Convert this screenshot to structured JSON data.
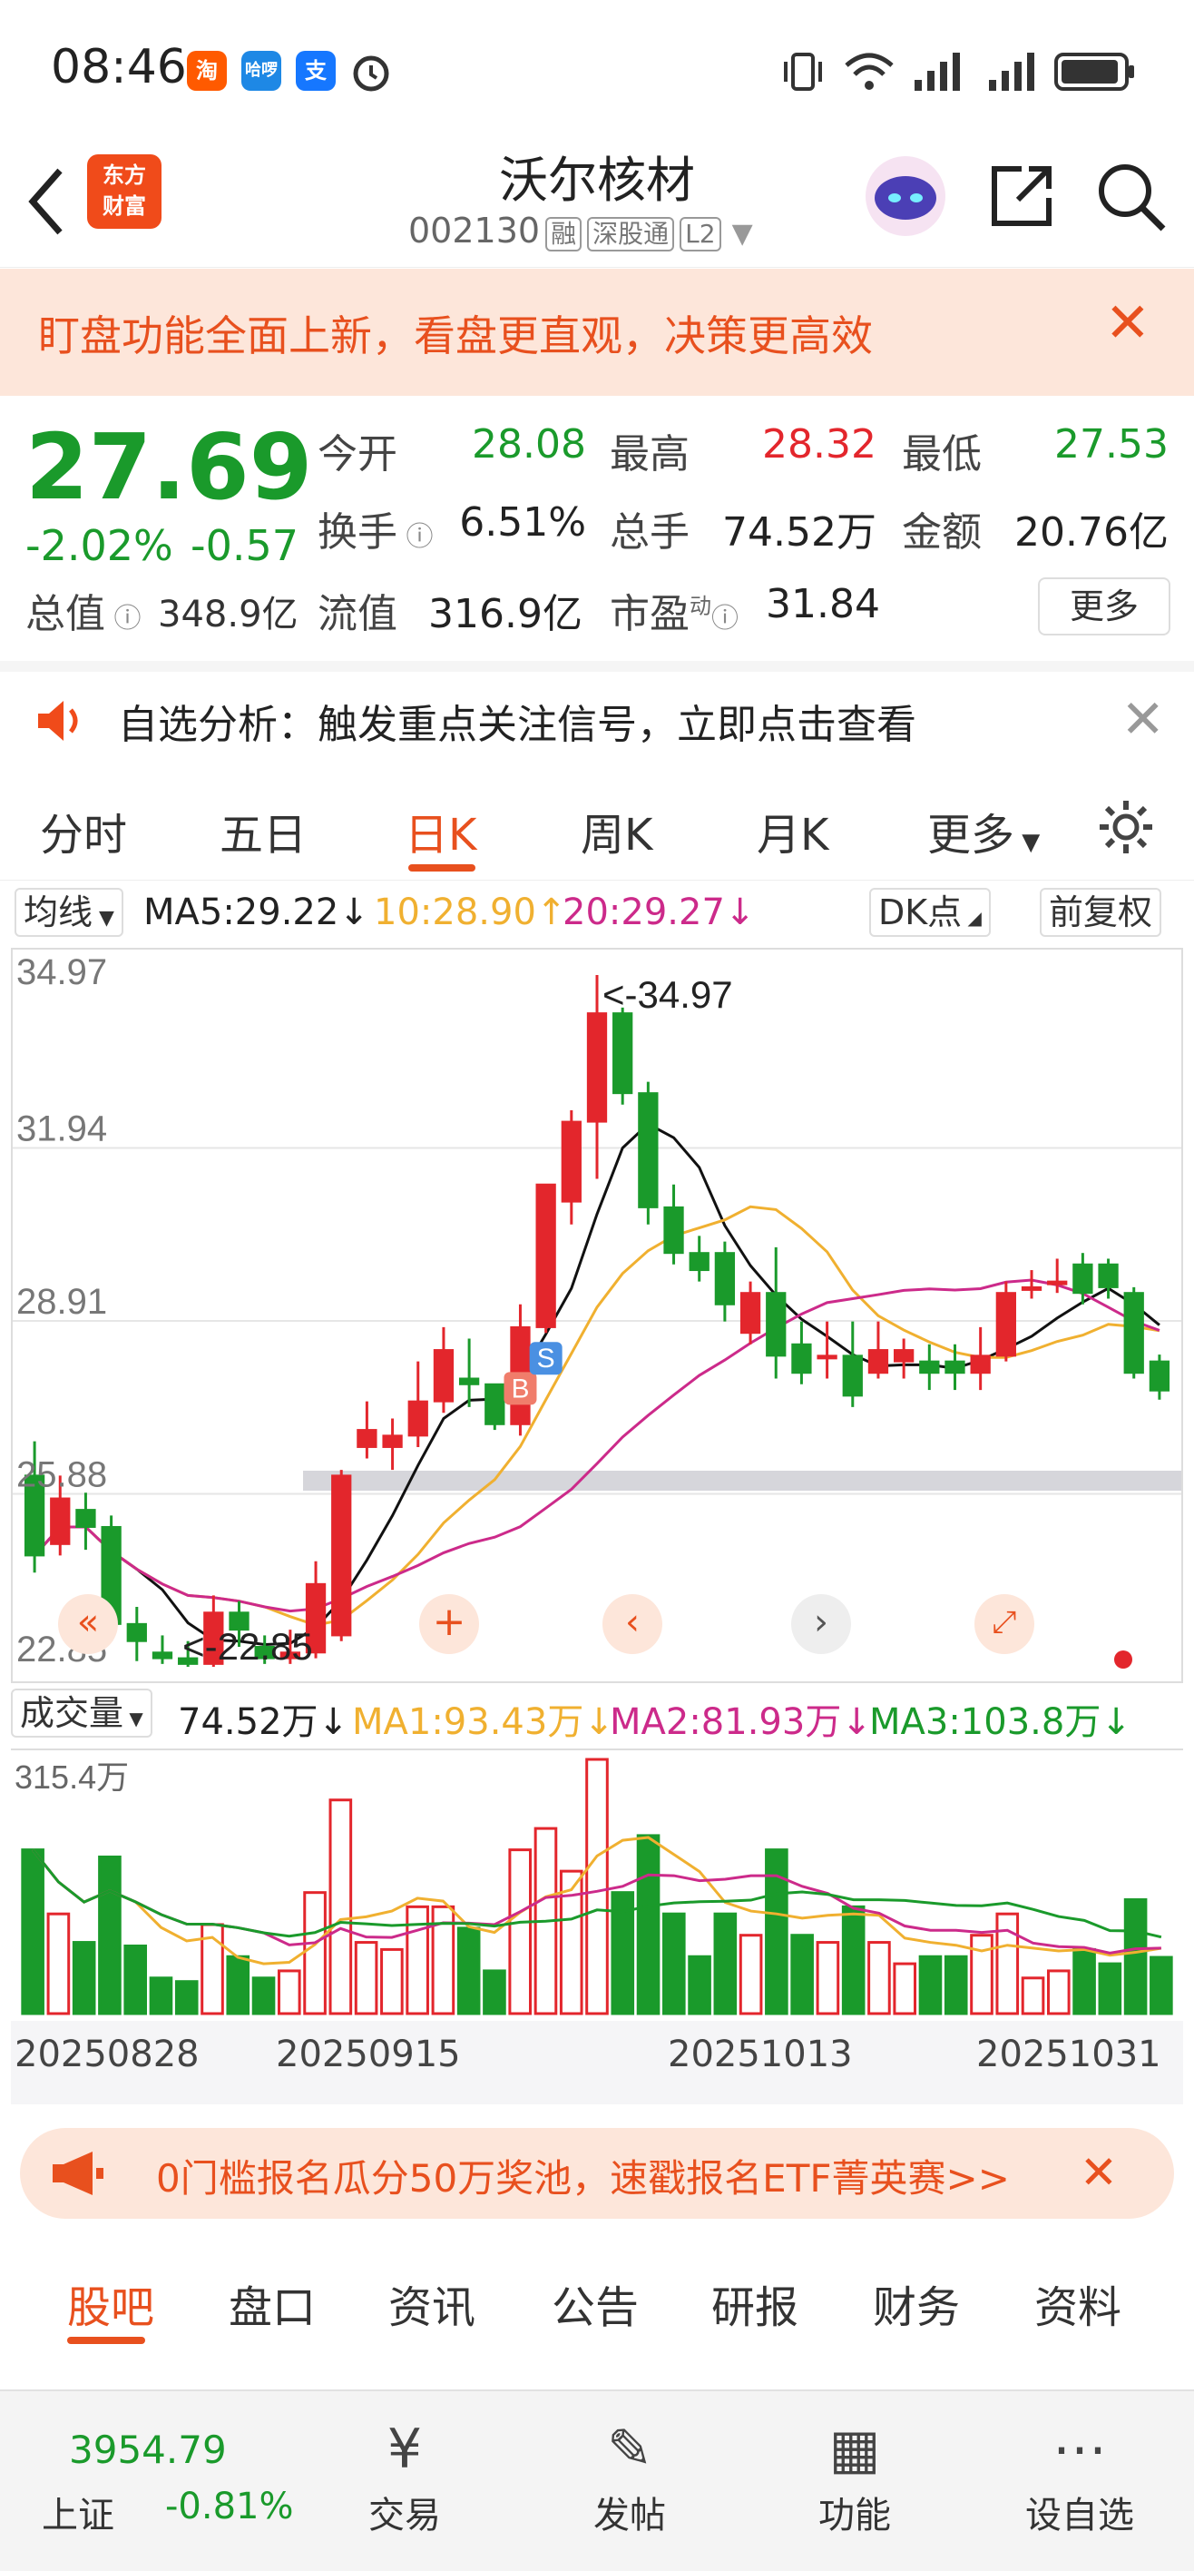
{
  "status_bar": {
    "time": "08:46",
    "apps": [
      "淘",
      "哈啰",
      "支"
    ]
  },
  "header": {
    "stock_name": "沃尔核材",
    "stock_code": "002130",
    "tags": [
      "融",
      "深股通",
      "L2"
    ],
    "logo_lines": [
      "东方",
      "财富"
    ]
  },
  "banner": {
    "text": "盯盘功能全面上新，看盘更直观，决策更高效"
  },
  "quote": {
    "price": "27.69",
    "change_pct": "-2.02%",
    "change_abs": "-0.57",
    "open_label": "今开",
    "open": "28.08",
    "high_label": "最高",
    "high": "28.32",
    "low_label": "最低",
    "low": "27.53",
    "turnover_label": "换手",
    "turnover": "6.51%",
    "volume_label": "总手",
    "volume": "74.52万",
    "amount_label": "金额",
    "amount": "20.76亿",
    "mktcap_label": "总值",
    "mktcap": "348.9亿",
    "float_label": "流值",
    "float": "316.9亿",
    "pe_label": "市盈",
    "pe_sup": "动",
    "pe": "31.84",
    "more": "更多"
  },
  "alert": {
    "text": "自选分析：触发重点关注信号，立即点击查看"
  },
  "chart_tabs": [
    "分时",
    "五日",
    "日K",
    "周K",
    "月K",
    "更多"
  ],
  "indicators": {
    "ma_select": "均线",
    "ma5": "MA5:29.22",
    "ma10": "10:28.90",
    "ma20": "20:29.27",
    "dk": "DK点",
    "fq": "前复权"
  },
  "colors": {
    "up": "#e3262c",
    "down": "#1a9a2b",
    "accent": "#e8501e",
    "ma5": "#111111",
    "ma10": "#f0b030",
    "ma20": "#cc2a8a"
  },
  "chart_data": {
    "type": "candlestick",
    "y_ticks": [
      "34.97",
      "31.94",
      "28.91",
      "25.88",
      "22.85"
    ],
    "ylim": [
      22.85,
      34.97
    ],
    "max_label": "34.97",
    "min_label": "22.85",
    "x_labels": [
      "20250828",
      "20250915",
      "20251013",
      "20251031"
    ],
    "candles": [
      [
        26.2,
        24.8,
        26.8,
        24.5
      ],
      [
        25.0,
        25.8,
        26.2,
        24.8
      ],
      [
        25.6,
        25.3,
        25.9,
        24.9
      ],
      [
        25.3,
        23.6,
        25.5,
        23.3
      ],
      [
        23.6,
        23.3,
        23.9,
        22.95
      ],
      [
        23.1,
        23.0,
        23.4,
        22.9
      ],
      [
        23.0,
        22.9,
        23.3,
        22.85
      ],
      [
        22.9,
        23.8,
        24.1,
        22.85
      ],
      [
        23.8,
        23.5,
        24.0,
        23.2
      ],
      [
        23.2,
        23.0,
        23.4,
        22.9
      ],
      [
        23.0,
        23.1,
        23.5,
        22.9
      ],
      [
        23.1,
        24.3,
        24.7,
        23.0
      ],
      [
        23.4,
        26.2,
        26.3,
        23.3
      ],
      [
        26.7,
        27.0,
        27.5,
        26.5
      ],
      [
        26.7,
        26.9,
        27.2,
        26.3
      ],
      [
        26.9,
        27.5,
        28.2,
        26.7
      ],
      [
        27.5,
        28.4,
        28.8,
        27.3
      ],
      [
        27.9,
        27.8,
        28.6,
        27.4
      ],
      [
        27.8,
        27.1,
        27.6,
        27.0
      ],
      [
        27.1,
        28.8,
        29.2,
        26.9
      ],
      [
        28.8,
        31.3,
        31.3,
        28.7
      ],
      [
        31.0,
        32.4,
        32.6,
        30.6
      ],
      [
        32.4,
        34.3,
        34.97,
        31.4
      ],
      [
        34.3,
        32.9,
        34.4,
        32.7
      ],
      [
        32.9,
        30.9,
        33.1,
        30.6
      ],
      [
        30.9,
        30.1,
        31.3,
        29.9
      ],
      [
        30.1,
        29.8,
        30.4,
        29.6
      ],
      [
        30.1,
        29.2,
        30.3,
        28.9
      ],
      [
        28.7,
        29.4,
        29.6,
        28.5
      ],
      [
        29.4,
        28.3,
        30.2,
        27.9
      ],
      [
        28.5,
        28.0,
        28.9,
        27.8
      ],
      [
        28.3,
        28.3,
        28.9,
        27.9
      ],
      [
        28.3,
        27.6,
        28.9,
        27.4
      ],
      [
        28.0,
        28.4,
        28.9,
        27.9
      ],
      [
        28.2,
        28.4,
        28.6,
        27.9
      ],
      [
        28.2,
        28.0,
        28.5,
        27.7
      ],
      [
        28.2,
        28.0,
        28.5,
        27.7
      ],
      [
        28.0,
        28.3,
        28.8,
        27.7
      ],
      [
        28.3,
        29.4,
        29.6,
        28.2
      ],
      [
        29.5,
        29.5,
        29.8,
        29.3
      ],
      [
        29.6,
        29.6,
        30.0,
        29.4
      ],
      [
        29.9,
        29.4,
        30.1,
        29.2
      ],
      [
        29.9,
        29.5,
        30.0,
        29.3
      ],
      [
        29.4,
        28.0,
        29.5,
        27.9
      ],
      [
        28.2,
        27.69,
        28.32,
        27.53
      ]
    ]
  },
  "volume": {
    "selector": "成交量",
    "vol": "74.52万",
    "ma1": "MA1:93.43万",
    "ma2": "MA2:81.93万",
    "ma3": "MA3:103.8万",
    "max_label": "315.4万"
  },
  "promo": {
    "text": "0门槛报名瓜分50万奖池，速戳报名ETF菁英赛>>"
  },
  "sub_tabs": [
    "股吧",
    "盘口",
    "资讯",
    "公告",
    "研报",
    "财务",
    "资料"
  ],
  "bottom": {
    "index_value": "3954.79",
    "index_name": "上证",
    "index_change": "-0.81%",
    "items": [
      "交易",
      "发帖",
      "功能",
      "设自选"
    ]
  }
}
